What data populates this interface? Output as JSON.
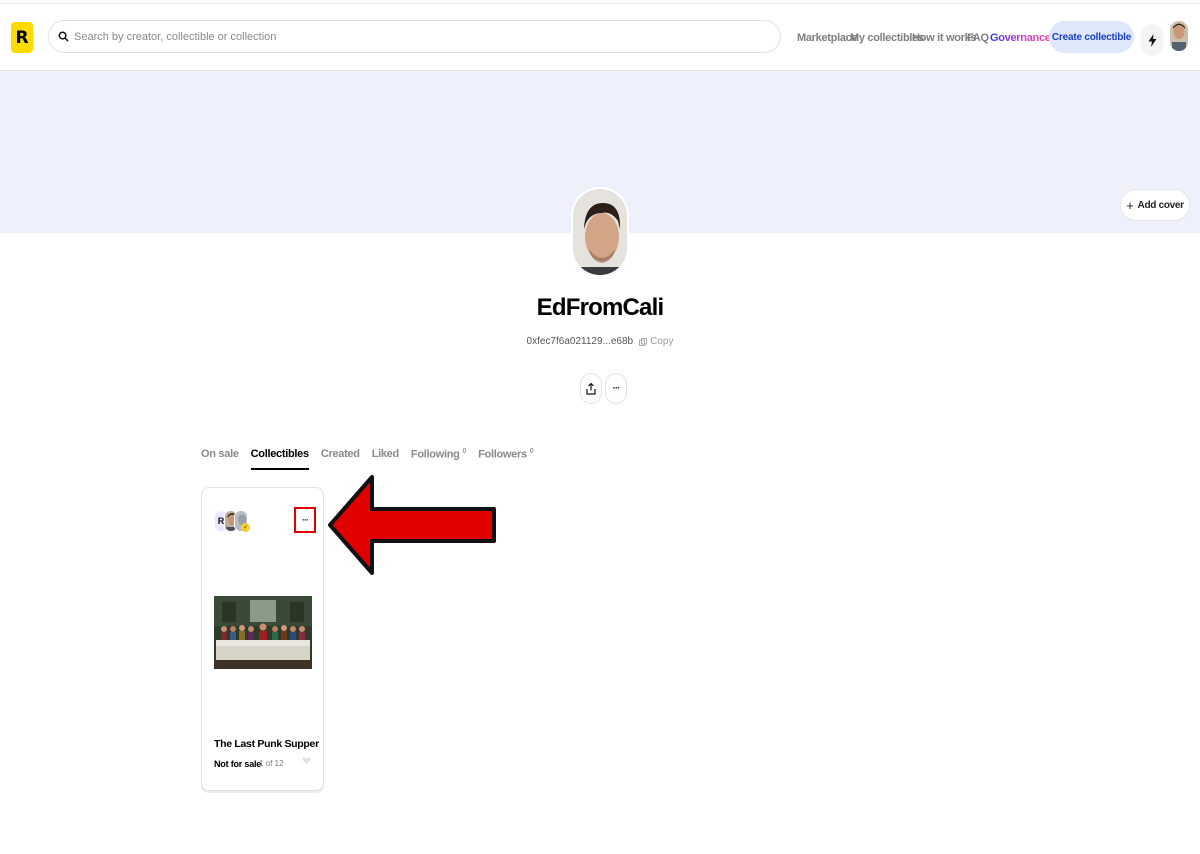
{
  "header": {
    "logo_letter": "R",
    "search_placeholder": "Search by creator, collectible or collection",
    "nav": [
      "Marketplace",
      "My collectibles",
      "How it works",
      "FAQ",
      "Governance"
    ],
    "create_label": "Create collectible"
  },
  "cover": {
    "add_cover_label": "Add cover"
  },
  "profile": {
    "name": "EdFromCali",
    "address": "0xfec7f6a021129...e68b",
    "copy_label": "Copy",
    "more_label": "···"
  },
  "tabs": [
    {
      "label": "On sale",
      "count": ""
    },
    {
      "label": "Collectibles",
      "count": ""
    },
    {
      "label": "Created",
      "count": ""
    },
    {
      "label": "Liked",
      "count": ""
    },
    {
      "label": "Following",
      "count": "0"
    },
    {
      "label": "Followers",
      "count": "0"
    }
  ],
  "card": {
    "badge_letter": "R",
    "more_label": "···",
    "title": "The Last Punk Supper",
    "status": "Not for sale",
    "edition": "1 of 12"
  },
  "colors": {
    "accent_yellow": "#feda03",
    "cover_bg": "#eef0fb",
    "create_btn_bg": "#dfe7fb",
    "create_btn_text": "#1a3ec7",
    "annotation_red": "#e00000"
  }
}
